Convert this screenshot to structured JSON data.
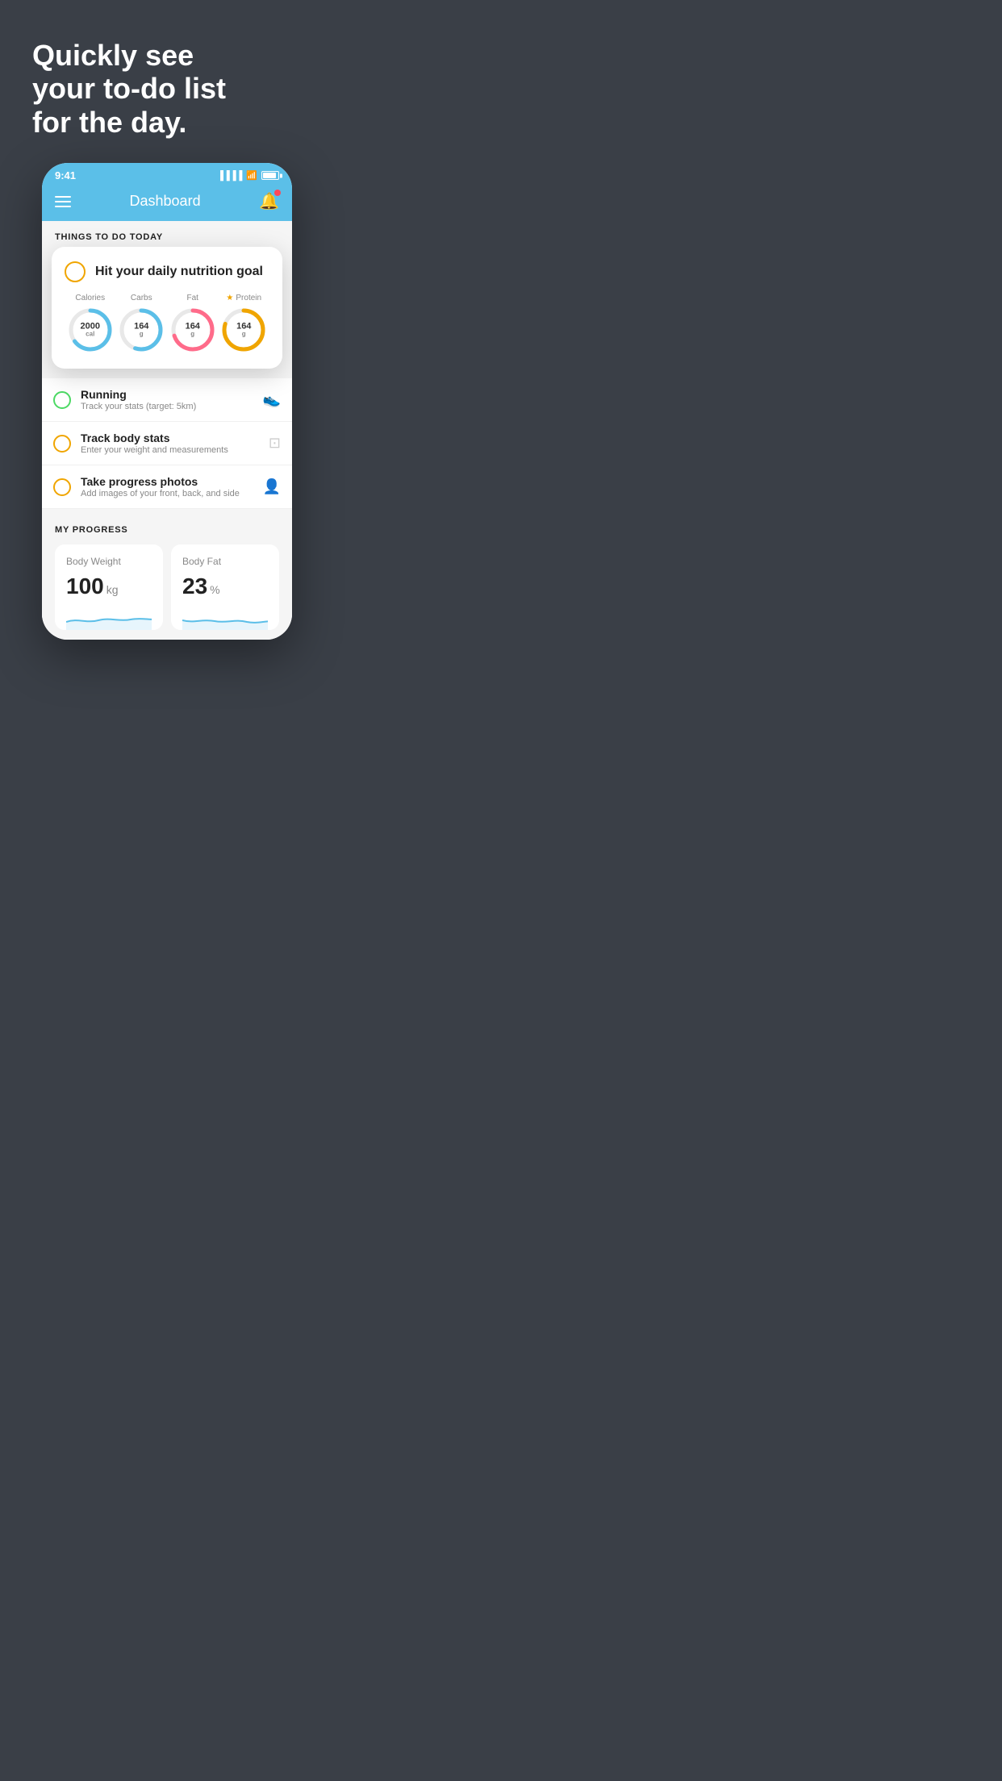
{
  "hero": {
    "line1": "Quickly see",
    "line2": "your to-do list",
    "line3": "for the day."
  },
  "statusBar": {
    "time": "9:41"
  },
  "navBar": {
    "title": "Dashboard"
  },
  "thingsToDoSection": {
    "heading": "THINGS TO DO TODAY"
  },
  "nutritionCard": {
    "title": "Hit your daily nutrition goal",
    "items": [
      {
        "label": "Calories",
        "value": "2000",
        "unit": "cal",
        "color": "#5bbfe8",
        "pct": 65
      },
      {
        "label": "Carbs",
        "value": "164",
        "unit": "g",
        "color": "#5bbfe8",
        "pct": 55
      },
      {
        "label": "Fat",
        "value": "164",
        "unit": "g",
        "color": "#ff6b8a",
        "pct": 70
      },
      {
        "label": "Protein",
        "value": "164",
        "unit": "g",
        "color": "#f0a500",
        "pct": 80,
        "starred": true
      }
    ]
  },
  "todoItems": [
    {
      "name": "Running",
      "sub": "Track your stats (target: 5km)",
      "circleColor": "green",
      "iconUnicode": "👟"
    },
    {
      "name": "Track body stats",
      "sub": "Enter your weight and measurements",
      "circleColor": "yellow",
      "iconUnicode": "⊡"
    },
    {
      "name": "Take progress photos",
      "sub": "Add images of your front, back, and side",
      "circleColor": "yellow",
      "iconUnicode": "👤"
    }
  ],
  "progressSection": {
    "heading": "MY PROGRESS",
    "cards": [
      {
        "title": "Body Weight",
        "value": "100",
        "unit": "kg"
      },
      {
        "title": "Body Fat",
        "value": "23",
        "unit": "%"
      }
    ]
  }
}
